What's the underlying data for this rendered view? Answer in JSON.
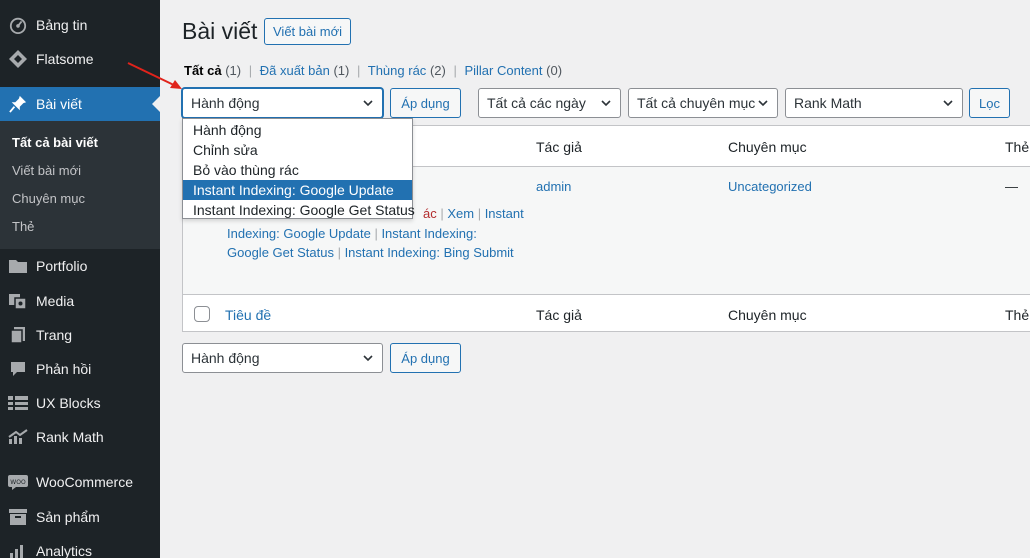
{
  "sidebar": {
    "items": [
      {
        "label": "Bảng tin",
        "icon": "dashboard-icon"
      },
      {
        "label": "Flatsome",
        "icon": "flatsome-icon"
      },
      {
        "label": "Bài viết",
        "icon": "pin-icon"
      },
      {
        "label": "Portfolio",
        "icon": "folder-icon"
      },
      {
        "label": "Media",
        "icon": "media-icon"
      },
      {
        "label": "Trang",
        "icon": "pages-icon"
      },
      {
        "label": "Phản hồi",
        "icon": "comments-icon"
      },
      {
        "label": "UX Blocks",
        "icon": "blocks-icon"
      },
      {
        "label": "Rank Math",
        "icon": "chart-icon"
      },
      {
        "label": "WooCommerce",
        "icon": "woocommerce-icon"
      },
      {
        "label": "Sản phẩm",
        "icon": "products-icon"
      },
      {
        "label": "Analytics",
        "icon": "analytics-icon"
      }
    ],
    "submenu": [
      "Tất cả bài viết",
      "Viết bài mới",
      "Chuyên mục",
      "Thẻ"
    ]
  },
  "header": {
    "title": "Bài viết",
    "add_new": "Viết bài mới"
  },
  "filters": {
    "all": "Tất cả",
    "all_count": "(1)",
    "published": "Đã xuất bản",
    "published_count": "(1)",
    "trash": "Thùng rác",
    "trash_count": "(2)",
    "pillar": "Pillar Content",
    "pillar_count": "(0)",
    "sep": "|"
  },
  "toolbar": {
    "bulk_action": "Hành động",
    "apply": "Áp dụng",
    "dates": "Tất cả các ngày",
    "categories": "Tất cả chuyên mục",
    "seo": "Rank Math",
    "filter": "Lọc"
  },
  "dropdown": {
    "options": [
      "Hành động",
      "Chỉnh sửa",
      "Bỏ vào thùng rác",
      "Instant Indexing: Google Update",
      "Instant Indexing: Google Get Status"
    ],
    "selected_index": 3
  },
  "table": {
    "columns": {
      "title": "Tiêu đề",
      "author": "Tác giả",
      "category": "Chuyên mục",
      "tags": "Thẻ"
    },
    "row": {
      "author": "admin",
      "category": "Uncategorized",
      "tags": "—",
      "actions_trash_tail": "ác",
      "action_view": "Xem",
      "action_instant": "Instant",
      "action_google_update": "Indexing: Google Update",
      "action_instant2": "Instant Indexing:",
      "action_google_status": "Google Get Status",
      "action_bing": "Instant Indexing: Bing Submit"
    }
  },
  "colors": {
    "sidebar_bg": "#1d2327",
    "accent": "#2271b1",
    "arrow": "#e0231b"
  }
}
